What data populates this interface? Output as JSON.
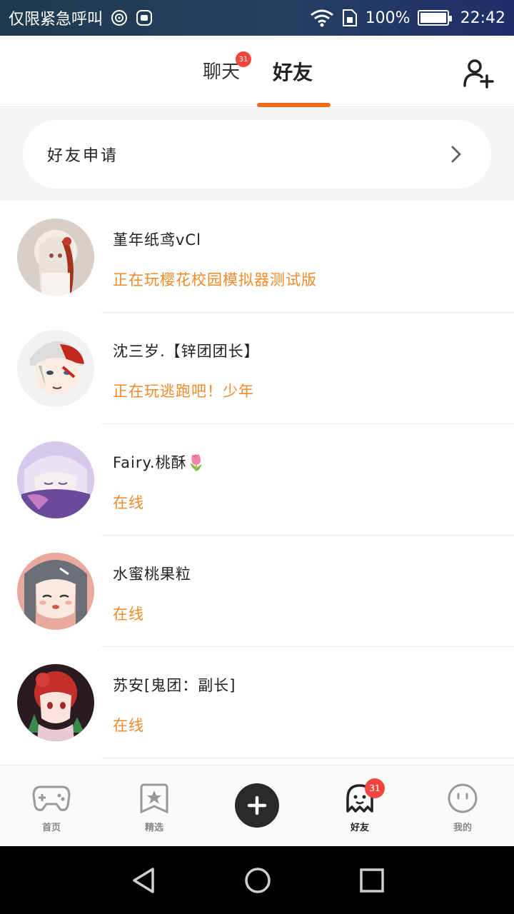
{
  "statusbar": {
    "carrier_text": "仅限紧急呼叫",
    "battery_text": "100%",
    "time": "22:42"
  },
  "header": {
    "tabs": [
      {
        "label": "聊天",
        "badge": "31"
      },
      {
        "label": "好友",
        "active": true
      }
    ],
    "accent_color": "#f26a1b"
  },
  "friend_request": {
    "label": "好友申请"
  },
  "friends": [
    {
      "name": "堇年纸鸢vCl",
      "status": "正在玩樱花校园模拟器测试版"
    },
    {
      "name": "沈三岁.【锌团团长】",
      "status": "正在玩逃跑吧！少年"
    },
    {
      "name": "Fairy.桃酥🌷",
      "status": "在线"
    },
    {
      "name": "水蜜桃果粒",
      "status": "在线"
    },
    {
      "name": "苏安[鬼团：副长]",
      "status": "在线"
    }
  ],
  "bottomnav": {
    "items": [
      {
        "label": "首页",
        "icon": "gamepad-icon"
      },
      {
        "label": "精选",
        "icon": "star-bookmark-icon"
      },
      {
        "label": "",
        "icon": "plus-icon"
      },
      {
        "label": "好友",
        "icon": "ghost-icon",
        "badge": "31"
      },
      {
        "label": "我的",
        "icon": "smiley-icon"
      }
    ]
  },
  "colors": {
    "status_text": "#f08a2a",
    "badge": "#f2453d"
  }
}
